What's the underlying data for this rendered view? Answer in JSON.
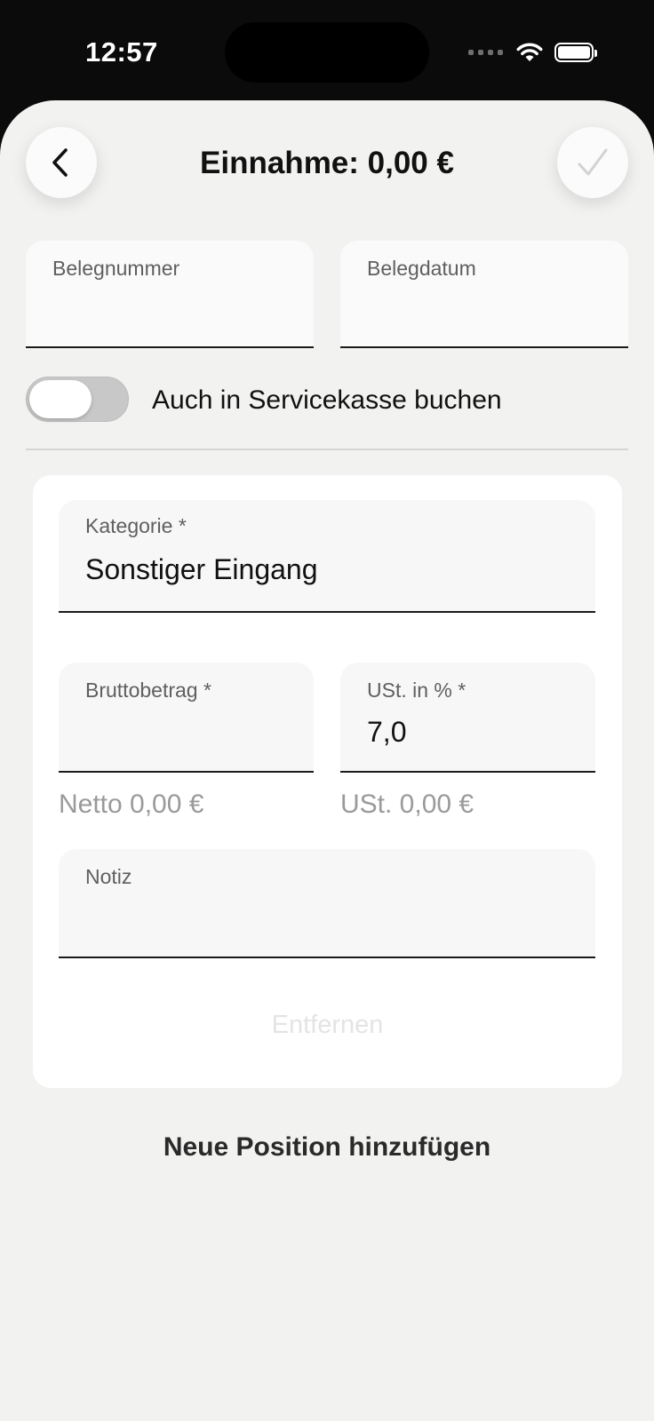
{
  "status_bar": {
    "time": "12:57"
  },
  "header": {
    "title": "Einnahme: 0,00 €",
    "back_icon": "chevron-left-icon",
    "confirm_icon": "checkmark-icon"
  },
  "receipt": {
    "number_label": "Belegnummer",
    "number_value": "",
    "date_label": "Belegdatum",
    "date_value": ""
  },
  "service_cash": {
    "label": "Auch in Servicekasse buchen",
    "enabled": false
  },
  "position": {
    "category_label": "Kategorie *",
    "category_value": "Sonstiger Eingang",
    "gross_label": "Bruttobetrag *",
    "gross_value": "",
    "vat_label": "USt. in % *",
    "vat_value": "7,0",
    "net_hint": "Netto 0,00 €",
    "vat_hint": "USt. 0,00 €",
    "note_label": "Notiz",
    "note_value": "",
    "remove_label": "Entfernen"
  },
  "add_position_label": "Neue Position hinzufügen"
}
